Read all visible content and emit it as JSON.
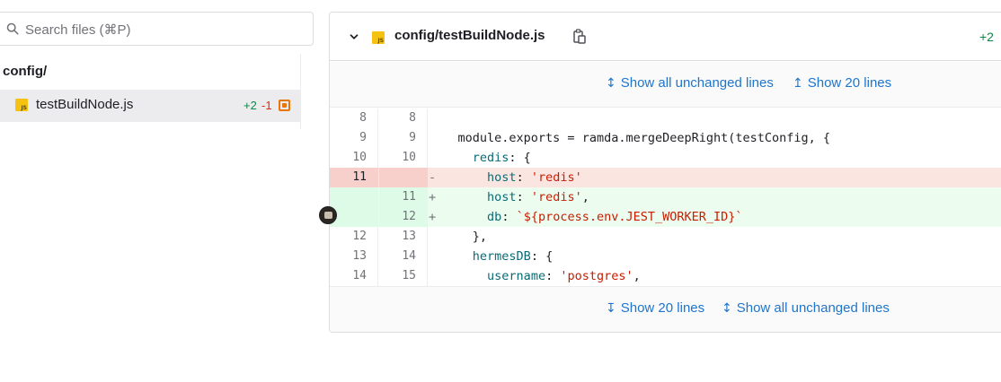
{
  "search": {
    "placeholder": "Search files (⌘P)"
  },
  "tree": {
    "folder": "config/",
    "file": {
      "name": "testBuildNode.js",
      "additions": "+2",
      "deletions": "-1"
    }
  },
  "diff": {
    "path": "config/testBuildNode.js",
    "additions": "+2",
    "file_type_badge": "JS",
    "expand_top": {
      "show_all": "Show all unchanged lines",
      "show_20": "Show 20 lines"
    },
    "expand_bottom": {
      "show_20": "Show 20 lines",
      "show_all": "Show all unchanged lines"
    },
    "lines": [
      {
        "type": "ctx",
        "old": "8",
        "new": "8",
        "sign": " ",
        "text": ""
      },
      {
        "type": "ctx",
        "old": "9",
        "new": "9",
        "sign": " ",
        "text": "module.exports = ramda.mergeDeepRight(testConfig, {"
      },
      {
        "type": "ctx",
        "old": "10",
        "new": "10",
        "sign": " ",
        "text": "  redis: {"
      },
      {
        "type": "del",
        "old": "11",
        "new": "",
        "sign": "-",
        "text": "    host: 'redis'"
      },
      {
        "type": "add",
        "old": "",
        "new": "11",
        "sign": "+",
        "text": "    host: 'redis',"
      },
      {
        "type": "add",
        "old": "",
        "new": "12",
        "sign": "+",
        "text": "    db: `${process.env.JEST_WORKER_ID}`"
      },
      {
        "type": "ctx",
        "old": "12",
        "new": "13",
        "sign": " ",
        "text": "  },"
      },
      {
        "type": "ctx",
        "old": "13",
        "new": "14",
        "sign": " ",
        "text": "  hermesDB: {"
      },
      {
        "type": "ctx",
        "old": "14",
        "new": "15",
        "sign": " ",
        "text": "    username: 'postgres',"
      }
    ]
  },
  "colors": {
    "link": "#1f75cb",
    "addition": "#108548",
    "deletion": "#dd2b0e",
    "del_bg": "#fbe5e1",
    "add_bg": "#ecfdf0"
  }
}
